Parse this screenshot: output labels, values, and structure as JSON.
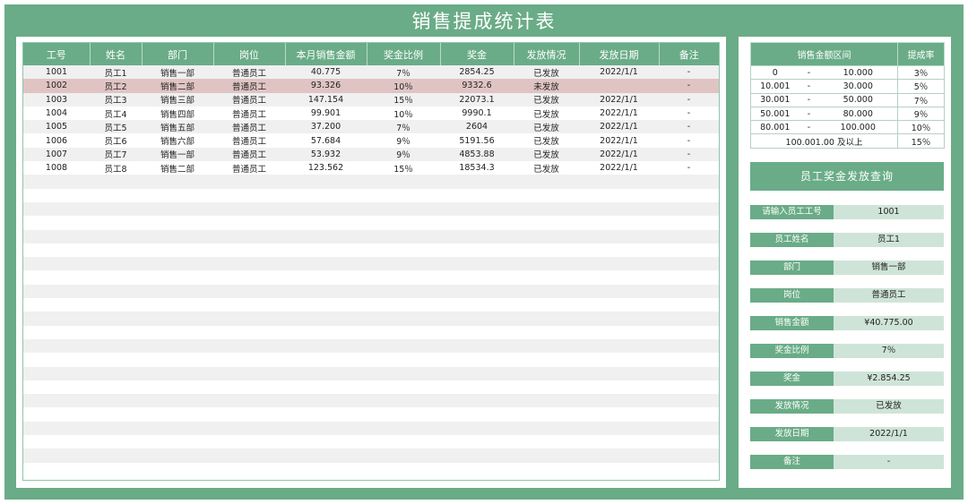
{
  "title": "销售提成统计表",
  "main_table": {
    "headers": [
      "工号",
      "姓名",
      "部门",
      "岗位",
      "本月销售金额",
      "奖金比例",
      "奖金",
      "发放情况",
      "发放日期",
      "备注"
    ],
    "rows": [
      [
        "1001",
        "员工1",
        "销售一部",
        "普通员工",
        "40.775",
        "7％",
        "2854.25",
        "已发放",
        "2022/1/1",
        "-"
      ],
      [
        "1002",
        "员工2",
        "销售二部",
        "普通员工",
        "93.326",
        "10％",
        "9332.6",
        "未发放",
        "",
        "-"
      ],
      [
        "1003",
        "员工3",
        "销售三部",
        "普通员工",
        "147.154",
        "15％",
        "22073.1",
        "已发放",
        "2022/1/1",
        "-"
      ],
      [
        "1004",
        "员工4",
        "销售四部",
        "普通员工",
        "99.901",
        "10％",
        "9990.1",
        "已发放",
        "2022/1/1",
        "-"
      ],
      [
        "1005",
        "员工5",
        "销售五部",
        "普通员工",
        "37.200",
        "7％",
        "2604",
        "已发放",
        "2022/1/1",
        "-"
      ],
      [
        "1006",
        "员工6",
        "销售六部",
        "普通员工",
        "57.684",
        "9％",
        "5191.56",
        "已发放",
        "2022/1/1",
        "-"
      ],
      [
        "1007",
        "员工7",
        "销售一部",
        "普通员工",
        "53.932",
        "9％",
        "4853.88",
        "已发放",
        "2022/1/1",
        "-"
      ],
      [
        "1008",
        "员工8",
        "销售二部",
        "普通员工",
        "123.562",
        "15％",
        "18534.3",
        "已发放",
        "2022/1/1",
        "-"
      ]
    ],
    "highlight_row_index": 1,
    "highlight_color": "#e0c4c4"
  },
  "rate_table": {
    "headers": [
      "销售金额区间",
      "提成率"
    ],
    "rows": [
      {
        "from": "0",
        "sep": "-",
        "to": "10.000",
        "rate": "3％"
      },
      {
        "from": "10.001",
        "sep": "-",
        "to": "30.000",
        "rate": "5％"
      },
      {
        "from": "30.001",
        "sep": "-",
        "to": "50.000",
        "rate": "7％"
      },
      {
        "from": "50.001",
        "sep": "-",
        "to": "80.000",
        "rate": "9％"
      },
      {
        "from": "80.001",
        "sep": "-",
        "to": "100.000",
        "rate": "10％"
      }
    ],
    "last_row": {
      "range": "100.001.00 及以上",
      "rate": "15％"
    }
  },
  "query": {
    "title": "员工奖金发放查询",
    "fields": [
      {
        "label": "请输入员工工号",
        "value": "1001"
      },
      {
        "label": "员工姓名",
        "value": "员工1"
      },
      {
        "label": "部门",
        "value": "销售一部"
      },
      {
        "label": "岗位",
        "value": "普通员工"
      },
      {
        "label": "销售金额",
        "value": "¥40.775.00"
      },
      {
        "label": "奖金比例",
        "value": "7％"
      },
      {
        "label": "奖金",
        "value": "¥2.854.25"
      },
      {
        "label": "发放情况",
        "value": "已发放"
      },
      {
        "label": "发放日期",
        "value": "2022/1/1"
      },
      {
        "label": "备注",
        "value": "-"
      }
    ]
  },
  "colors": {
    "accent": "#6aac87",
    "query_value_bg": "#cfe4d8",
    "stripe": "#f0f0f0"
  }
}
